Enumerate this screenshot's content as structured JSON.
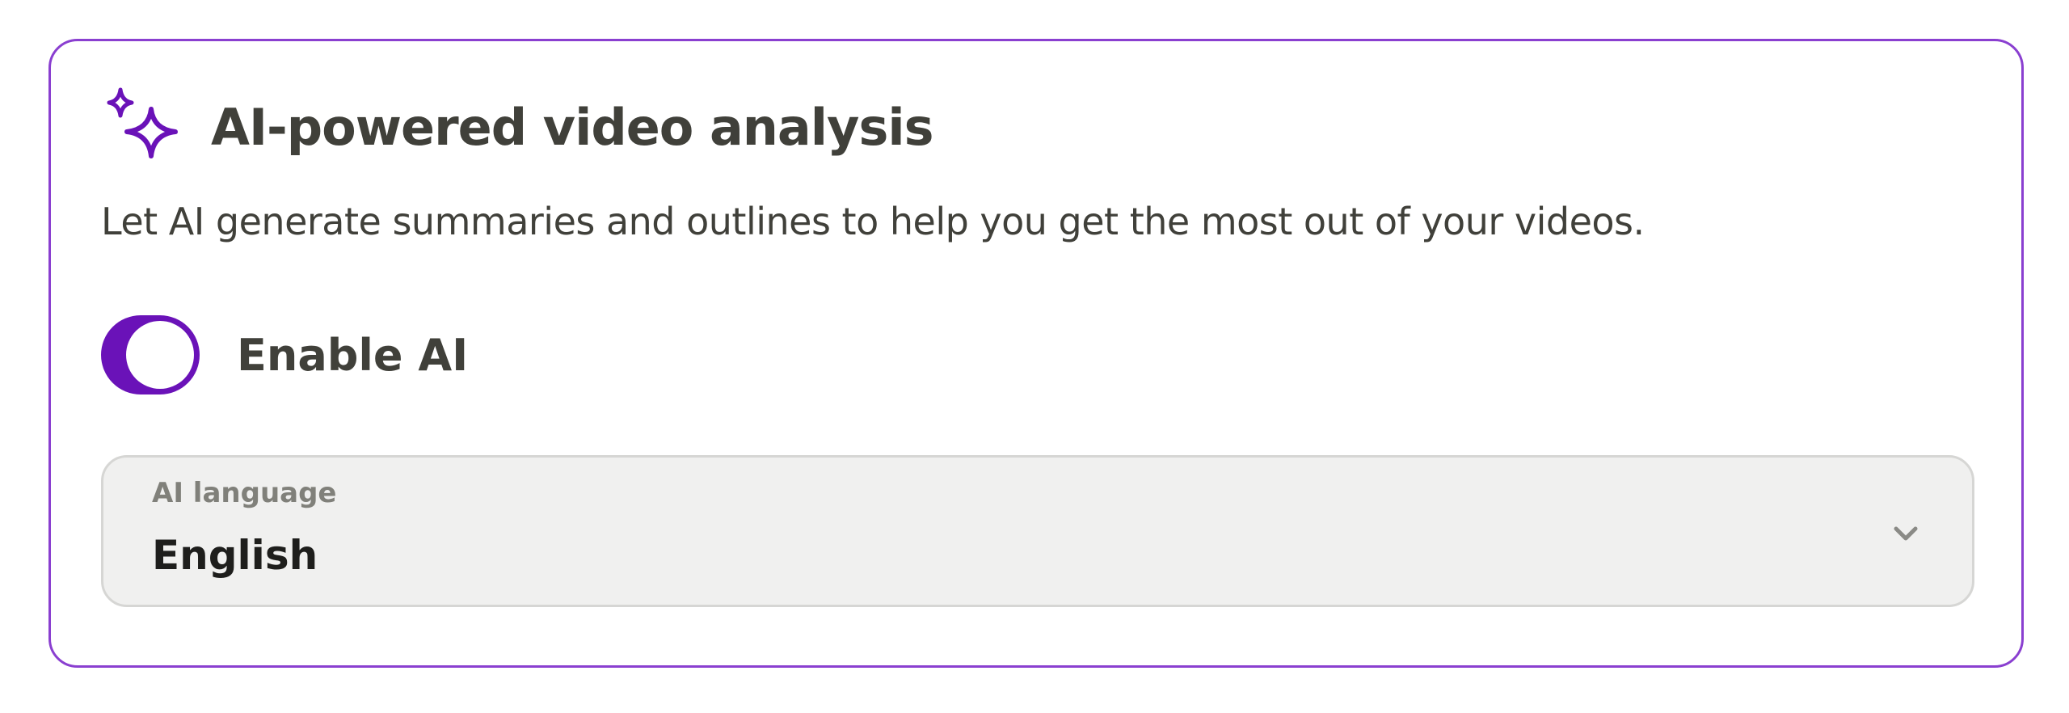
{
  "card": {
    "title": "AI-powered video analysis",
    "description": "Let AI generate summaries and outlines to help you get the most out of your videos.",
    "icon": "sparkles-icon"
  },
  "toggle": {
    "label": "Enable AI",
    "enabled": true
  },
  "language_select": {
    "label": "AI language",
    "value": "English",
    "icon": "chevron-down-icon"
  },
  "colors": {
    "accent": "#6a12b8",
    "border": "#8a3fd0",
    "text": "#40403a",
    "select_bg": "#f0f0ef"
  }
}
